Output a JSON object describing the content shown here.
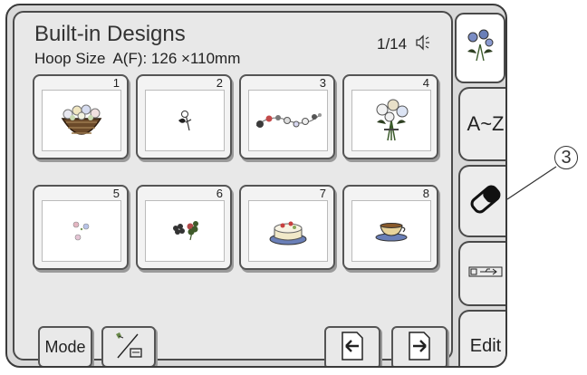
{
  "header": {
    "title": "Built-in Designs",
    "hoop_label": "Hoop Size",
    "hoop_value": "A(F): 126 ×110mm",
    "page_indicator": "1/14"
  },
  "designs": [
    {
      "number": "1",
      "icon": "flower-basket"
    },
    {
      "number": "2",
      "icon": "single-rose"
    },
    {
      "number": "3",
      "icon": "flower-garland"
    },
    {
      "number": "4",
      "icon": "flower-bouquet"
    },
    {
      "number": "5",
      "icon": "small-flowers"
    },
    {
      "number": "6",
      "icon": "clover-flower"
    },
    {
      "number": "7",
      "icon": "cake"
    },
    {
      "number": "8",
      "icon": "teacup"
    }
  ],
  "footer": {
    "mode_label": "Mode",
    "resize_icon": "resize-icon",
    "prev_icon": "arrow-left-icon",
    "next_icon": "arrow-right-icon"
  },
  "side_tabs": {
    "top_icon": "flower-design-icon",
    "az_label": "A~Z",
    "eraser_icon": "eraser-icon",
    "usb_icon": "usb-icon",
    "edit_label": "Edit"
  },
  "callout": {
    "label": "3"
  },
  "colors": {
    "background": "#d9d9d9",
    "panel": "#e8e8e8",
    "border": "#4a4a4a"
  }
}
